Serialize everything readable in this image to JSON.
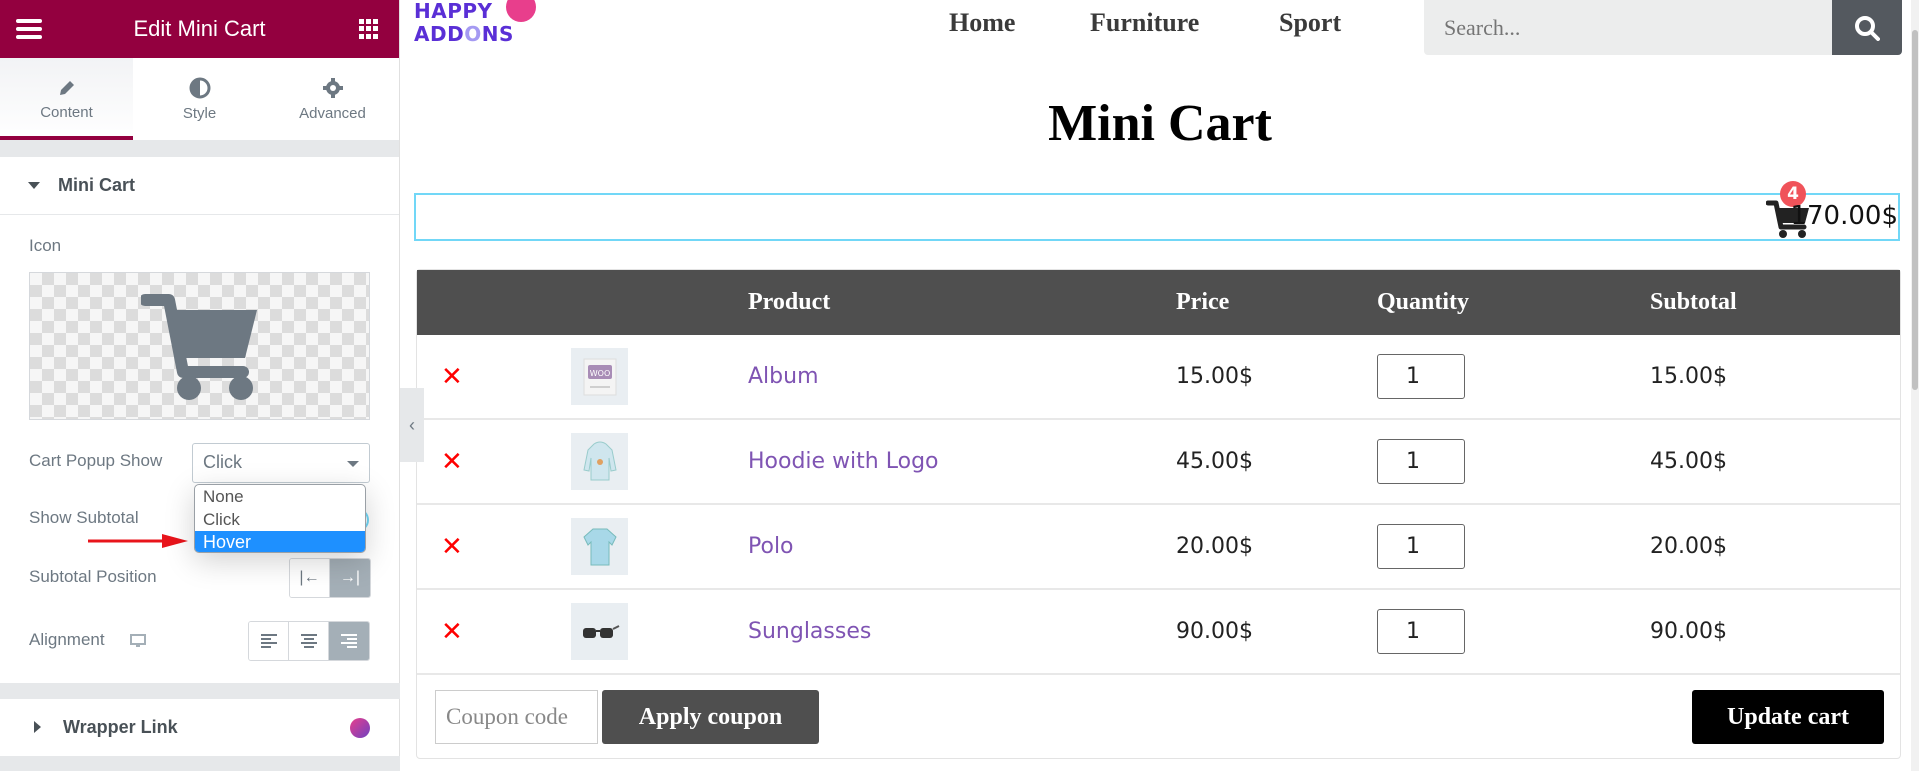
{
  "editor": {
    "title": "Edit Mini Cart",
    "tabs": [
      {
        "label": "Content",
        "icon": "pencil-icon",
        "active": true
      },
      {
        "label": "Style",
        "icon": "half-circle-icon",
        "active": false
      },
      {
        "label": "Advanced",
        "icon": "gear-icon",
        "active": false
      }
    ],
    "section_title": "Mini Cart",
    "icon_label": "Icon",
    "cart_popup_show": {
      "label": "Cart Popup Show",
      "value": "Click",
      "options": [
        "None",
        "Click",
        "Hover"
      ],
      "highlighted": "Hover"
    },
    "show_subtotal_label": "Show Subtotal",
    "subtotal_position": {
      "label": "Subtotal Position",
      "options": [
        "left",
        "right"
      ],
      "selected": "right"
    },
    "alignment": {
      "label": "Alignment",
      "options": [
        "left",
        "center",
        "right"
      ],
      "selected": "right"
    },
    "wrapper_link_title": "Wrapper Link",
    "accent_color": "#93003f"
  },
  "site": {
    "logo_line1": "HAPPY",
    "logo_line2a": "ADD",
    "logo_line2b": "O",
    "logo_line2c": "NS",
    "nav": [
      "Home",
      "Furniture",
      "Sport"
    ],
    "search_placeholder": "Search...",
    "page_title": "Mini Cart"
  },
  "mini_cart": {
    "count": "4",
    "total": "170.00$"
  },
  "cart": {
    "headers": [
      "",
      "",
      "Product",
      "Price",
      "Quantity",
      "Subtotal"
    ],
    "rows": [
      {
        "product": "Album",
        "price": "15.00$",
        "qty": "1",
        "subtotal": "15.00$",
        "thumb": "album-thumbnail"
      },
      {
        "product": "Hoodie with Logo",
        "price": "45.00$",
        "qty": "1",
        "subtotal": "45.00$",
        "thumb": "hoodie-thumbnail"
      },
      {
        "product": "Polo",
        "price": "20.00$",
        "qty": "1",
        "subtotal": "20.00$",
        "thumb": "polo-thumbnail"
      },
      {
        "product": "Sunglasses",
        "price": "90.00$",
        "qty": "1",
        "subtotal": "90.00$",
        "thumb": "sunglasses-thumbnail"
      }
    ],
    "remove_symbol": "✕",
    "coupon_placeholder": "Coupon code",
    "apply_coupon": "Apply coupon",
    "update_cart": "Update cart"
  }
}
